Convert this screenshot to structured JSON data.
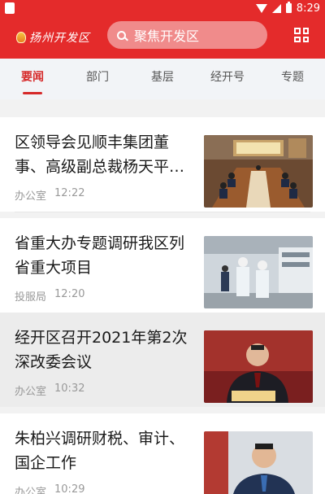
{
  "status_bar": {
    "time": "8:29"
  },
  "header": {
    "logo_text": "扬州开发区",
    "search_placeholder": "聚焦开发区"
  },
  "tabs": [
    {
      "label": "要闻",
      "active": true
    },
    {
      "label": "部门"
    },
    {
      "label": "基层"
    },
    {
      "label": "经开号"
    },
    {
      "label": "专题"
    }
  ],
  "articles": [
    {
      "title": "区领导会见顺丰集团董事、高级副总裁杨天平…",
      "source": "办公室",
      "time": "12:22",
      "image": "meeting-room-photo"
    },
    {
      "title": "省重大办专题调研我区列省重大项目",
      "source": "投服局",
      "time": "12:20",
      "image": "factory-visit-photo"
    },
    {
      "title": "经开区召开2021年第2次深改委会议",
      "source": "办公室",
      "time": "10:32",
      "image": "speaker-photo"
    },
    {
      "title": "朱柏兴调研财税、审计、国企工作",
      "source": "办公室",
      "time": "10:29",
      "image": "official-portrait-photo"
    }
  ]
}
